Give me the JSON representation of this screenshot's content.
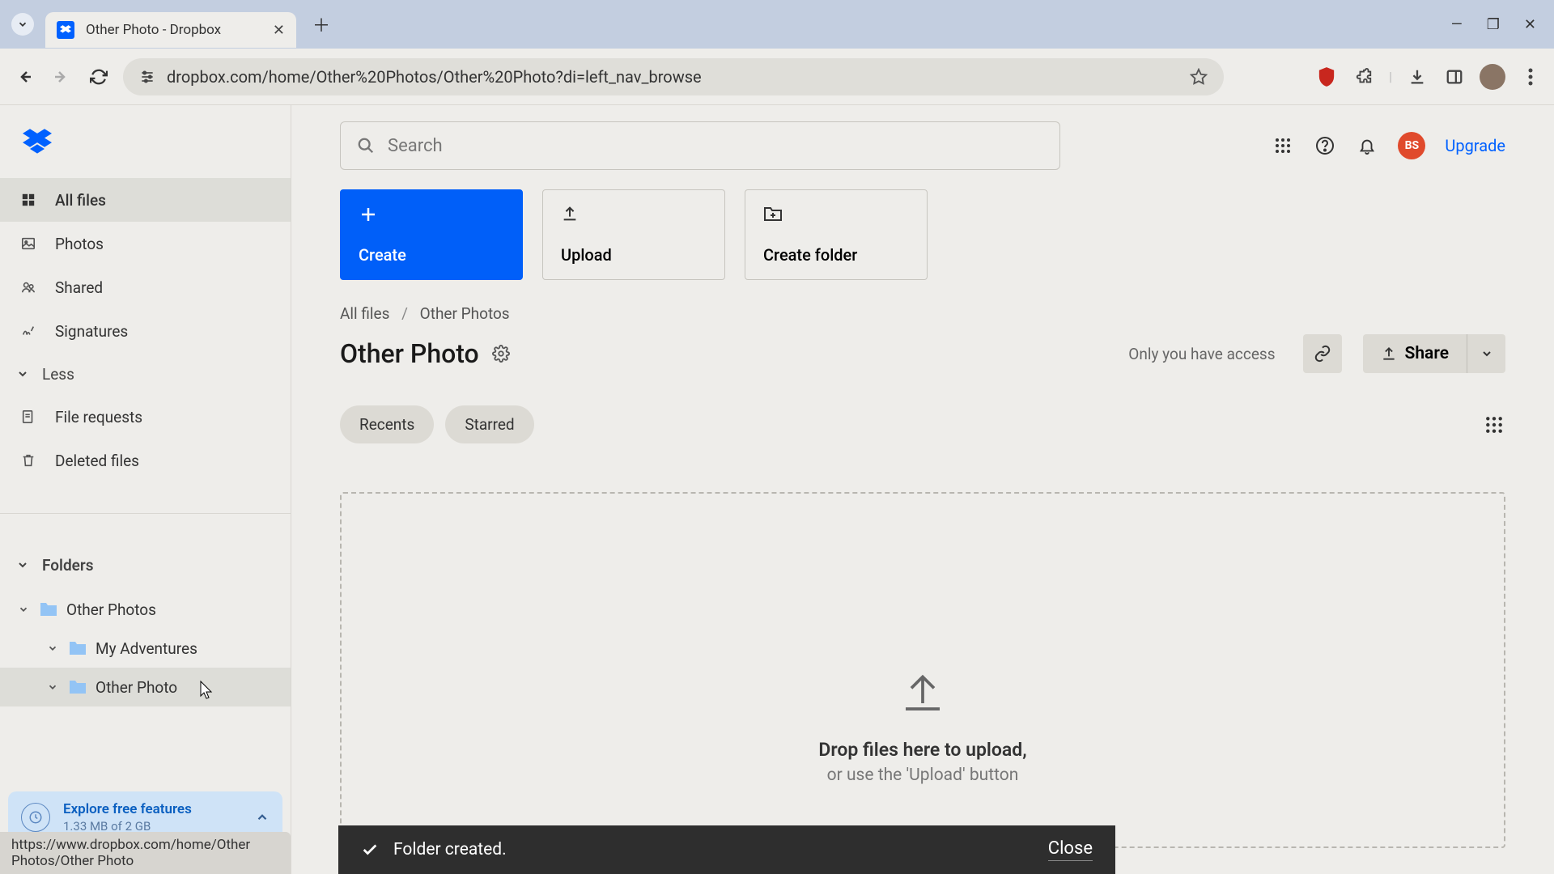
{
  "browser": {
    "tab_title": "Other Photo - Dropbox",
    "url": "dropbox.com/home/Other%20Photos/Other%20Photo?di=left_nav_browse",
    "avatar_initials": "BS"
  },
  "sidebar": {
    "nav": {
      "all_files": "All files",
      "photos": "Photos",
      "shared": "Shared",
      "signatures": "Signatures",
      "less": "Less",
      "file_requests": "File requests",
      "deleted_files": "Deleted files"
    },
    "folders_header": "Folders",
    "tree": {
      "root": "Other Photos",
      "child1": "My Adventures",
      "child2": "Other Photo"
    },
    "explore": {
      "title": "Explore free features",
      "storage": "1.33 MB of 2 GB"
    },
    "status_hover": "https://www.dropbox.com/home/Other Photos/Other Photo"
  },
  "main": {
    "search_placeholder": "Search",
    "upgrade": "Upgrade",
    "avatar_initials": "BS",
    "actions": {
      "create": "Create",
      "upload": "Upload",
      "create_folder": "Create folder"
    },
    "breadcrumbs": {
      "all_files": "All files",
      "parent": "Other Photos"
    },
    "page_title": "Other Photo",
    "access_text": "Only you have access",
    "share_label": "Share",
    "chips": {
      "recents": "Recents",
      "starred": "Starred"
    },
    "dropzone": {
      "line1": "Drop files here to upload,",
      "line2": "or use the 'Upload' button"
    },
    "toast": {
      "message": "Folder created.",
      "close": "Close"
    }
  }
}
